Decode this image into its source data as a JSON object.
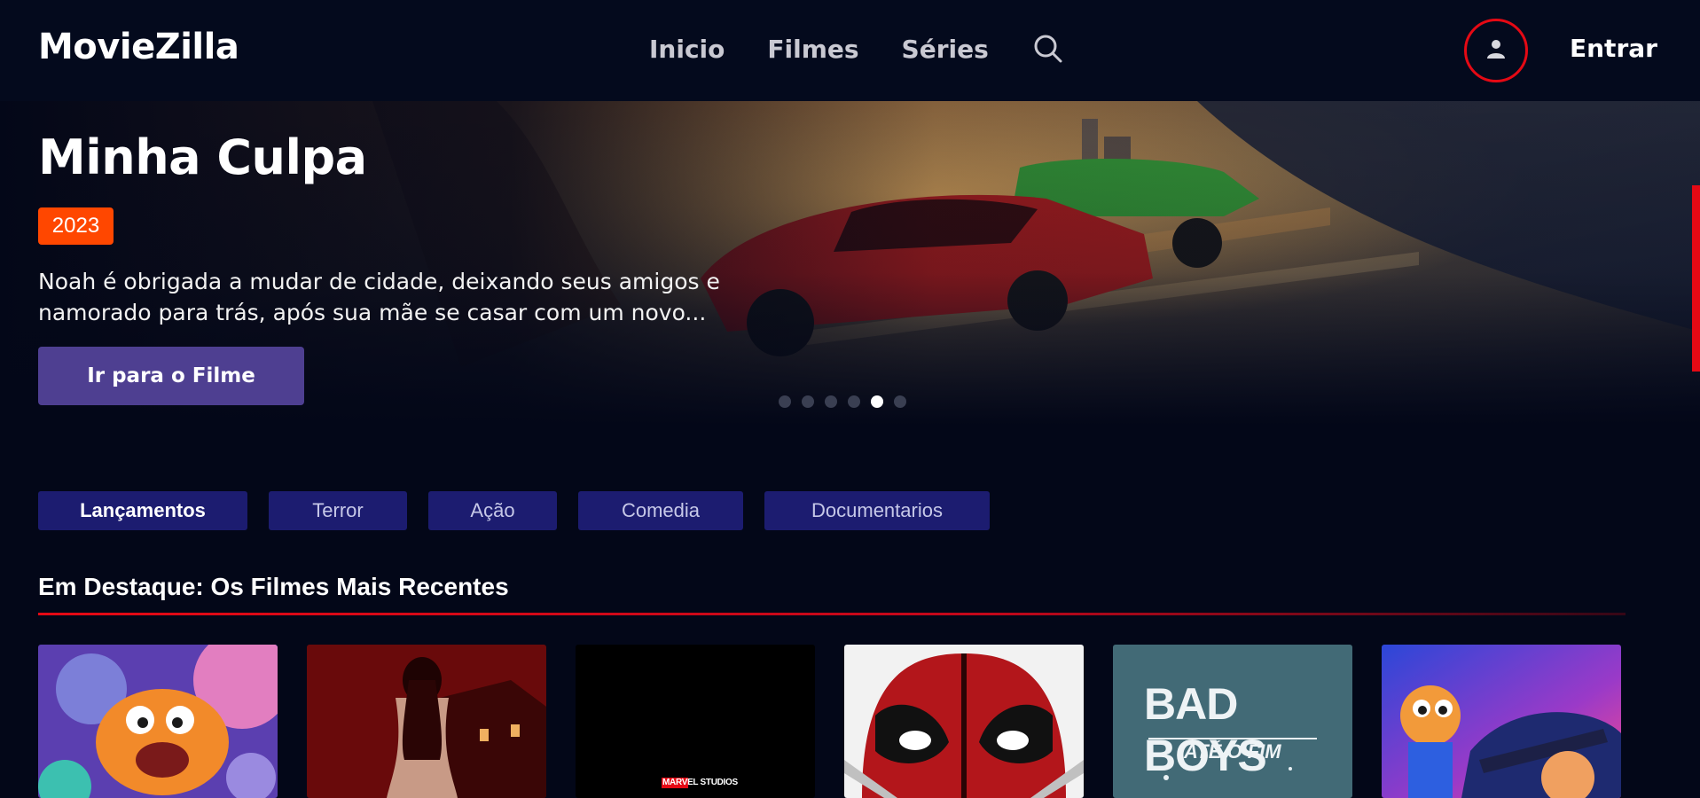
{
  "header": {
    "logo": "MovieZilla",
    "nav": [
      {
        "label": "Inicio"
      },
      {
        "label": "Filmes"
      },
      {
        "label": "Séries"
      }
    ],
    "search_icon": "search-icon",
    "user_icon": "user-icon",
    "login_label": "Entrar"
  },
  "hero": {
    "title": "Minha Culpa",
    "year": "2023",
    "description_line1": "Noah é obrigada a mudar de cidade, deixando seus amigos e",
    "description_line2": "namorado para trás, após sua mãe se casar com um novo...",
    "button_label": "Ir para o Filme",
    "carousel_total": 6,
    "carousel_active_index": 4
  },
  "categories": [
    {
      "label": "Lançamentos",
      "active": true
    },
    {
      "label": "Terror",
      "active": false
    },
    {
      "label": "Ação",
      "active": false
    },
    {
      "label": "Comedia",
      "active": false
    },
    {
      "label": "Documentarios",
      "active": false
    }
  ],
  "section": {
    "title": "Em Destaque: Os Filmes Mais Recentes"
  },
  "movies": [
    {
      "poster_text": ""
    },
    {
      "poster_text": ""
    },
    {
      "poster_text": "MARVEL STUDIOS"
    },
    {
      "poster_text": ""
    },
    {
      "poster_text": "BAD BOYS",
      "poster_subtext": "ATÉ O FIM"
    },
    {
      "poster_text": ""
    }
  ],
  "colors": {
    "background": "#030718",
    "accent_red": "#e50914",
    "year_badge": "#ff4700",
    "hero_button": "#4e3f91",
    "category_bg": "#1c1c70"
  }
}
